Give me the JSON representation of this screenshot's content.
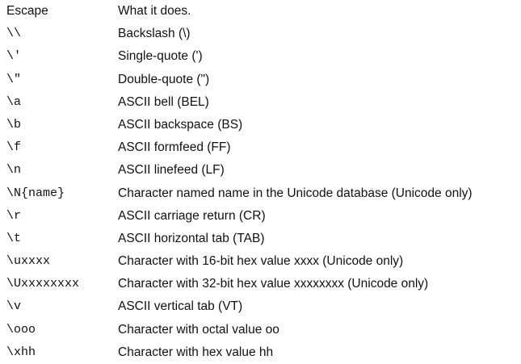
{
  "header": {
    "escape": "Escape",
    "description": "What it does."
  },
  "rows": [
    {
      "escape": "\\\\",
      "description": "Backslash (\\)"
    },
    {
      "escape": "\\'",
      "description": "Single-quote (')"
    },
    {
      "escape": "\\\"",
      "description": "Double-quote (\")"
    },
    {
      "escape": "\\a",
      "description": "ASCII bell (BEL)"
    },
    {
      "escape": "\\b",
      "description": "ASCII backspace (BS)"
    },
    {
      "escape": "\\f",
      "description": "ASCII formfeed (FF)"
    },
    {
      "escape": "\\n",
      "description": "ASCII linefeed (LF)"
    },
    {
      "escape": "\\N{name}",
      "description": "Character named name in the Unicode database (Unicode only)"
    },
    {
      "escape": "\\r",
      "description": "ASCII carriage return (CR)"
    },
    {
      "escape": "\\t",
      "description": "ASCII horizontal tab (TAB)"
    },
    {
      "escape": "\\uxxxx",
      "description": "Character with 16-bit hex value xxxx (Unicode only)"
    },
    {
      "escape": "\\Uxxxxxxxx",
      "description": "Character with 32-bit hex value xxxxxxxx (Unicode only)"
    },
    {
      "escape": "\\v",
      "description": "ASCII vertical tab (VT)"
    },
    {
      "escape": "\\ooo",
      "description": "Character with octal value oo"
    },
    {
      "escape": "\\xhh",
      "description": "Character with hex value hh"
    }
  ]
}
